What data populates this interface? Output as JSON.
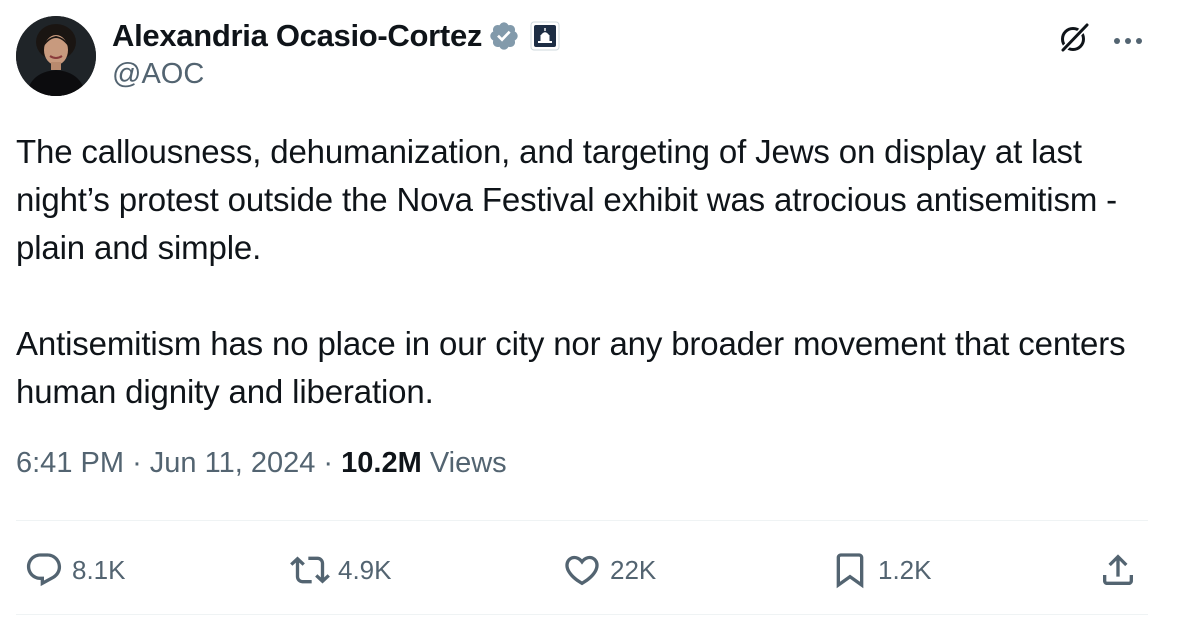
{
  "author": {
    "display_name": "Alexandria Ocasio-Cortez",
    "handle": "@AOC",
    "verified_badge_color": "#829aab",
    "affiliation_badge_color": "#1d2d44"
  },
  "tweet": {
    "paragraphs": [
      "The callousness, dehumanization, and targeting of Jews on display at last night’s protest outside the Nova Festival exhibit was atrocious antisemitism - plain and simple.",
      "Antisemitism has no place in our city nor any broader movement that centers human dignity and liberation."
    ],
    "time": "6:41 PM",
    "date": "Jun 11, 2024",
    "separator": "·",
    "views_count": "10.2M",
    "views_label": "Views"
  },
  "actions": {
    "reply": {
      "icon": "reply-icon",
      "count": "8.1K"
    },
    "repost": {
      "icon": "repost-icon",
      "count": "4.9K"
    },
    "like": {
      "icon": "heart-icon",
      "count": "22K"
    },
    "bookmark": {
      "icon": "bookmark-icon",
      "count": "1.2K"
    },
    "share": {
      "icon": "share-icon"
    }
  },
  "header_icons": [
    "grok-icon",
    "more-icon"
  ],
  "colors": {
    "text": "#0f1419",
    "secondary": "#536471",
    "divider": "#eff3f4"
  }
}
